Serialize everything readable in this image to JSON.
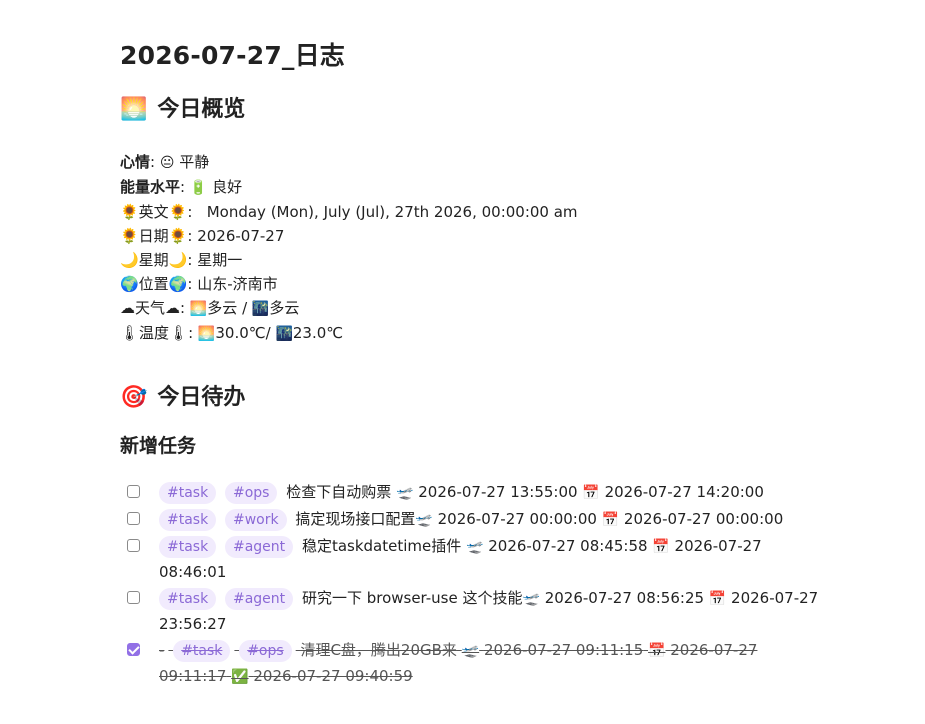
{
  "title": "2026-07-27_日志",
  "overview": {
    "heading_icon": "🌅",
    "heading": "今日概览",
    "mood_label": "心情",
    "mood_icon": "😐",
    "mood_value": "平静",
    "energy_label": "能量水平",
    "energy_icon": "🔋",
    "energy_value": "良好",
    "english_label": "🌻英文🌻",
    "english_value": "Monday (Mon), July (Jul), 27th 2026, 00:00:00 am",
    "date_label": "🌻日期🌻",
    "date_value": "2026-07-27",
    "weekday_label": "🌙星期🌙",
    "weekday_value": "星期一",
    "location_label": "🌍位置🌍",
    "location_value": "山东-济南市",
    "weather_label": "☁天气☁",
    "weather_day_icon": "🌅",
    "weather_day": "多云",
    "weather_night_icon": "🌃",
    "weather_night": "多云",
    "temp_label": "🌡温度🌡",
    "temp_day_icon": "🌅",
    "temp_day": "30.0℃/",
    "temp_night_icon": "🌃",
    "temp_night": "23.0℃"
  },
  "todo": {
    "heading_icon": "🎯",
    "heading": "今日待办",
    "subheading": "新增任务",
    "tasks": [
      {
        "checked": false,
        "tags": [
          "#task",
          "#ops"
        ],
        "text": "检查下自动购票",
        "created_icon": "🛫",
        "created": "2026-07-27 13:55:00",
        "due_icon": "📅",
        "due": "2026-07-27 14:20:00"
      },
      {
        "checked": false,
        "tags": [
          "#task",
          "#work"
        ],
        "text": "搞定现场接口配置",
        "created_icon": "🛫",
        "created": "2026-07-27 00:00:00",
        "due_icon": "📅",
        "due": "2026-07-27 00:00:00"
      },
      {
        "checked": false,
        "tags": [
          "#task",
          "#agent"
        ],
        "text": "稳定taskdatetime插件",
        "created_icon": "🛫",
        "created": "2026-07-27 08:45:58",
        "due_icon": "📅",
        "due": "2026-07-27 08:46:01"
      },
      {
        "checked": false,
        "tags": [
          "#task",
          "#agent"
        ],
        "text": "研究一下 browser-use 这个技能",
        "created_icon": "🛫",
        "created": "2026-07-27 08:56:25",
        "due_icon": "📅",
        "due": "2026-07-27 23:56:27"
      },
      {
        "checked": true,
        "dash": "-",
        "tags": [
          "#task",
          "#ops"
        ],
        "text": "清理C盘，腾出20GB来",
        "created_icon": "🛫",
        "created": "2026-07-27 09:11:15",
        "due_icon": "📅",
        "due": "2026-07-27 09:11:17",
        "done_icon": "✅",
        "done": "2026-07-27 09:40:59"
      }
    ]
  },
  "colors": {
    "tag_bg": "#f1ebfd",
    "tag_text": "#8b69d6",
    "checkbox_checked": "#9270e6"
  }
}
